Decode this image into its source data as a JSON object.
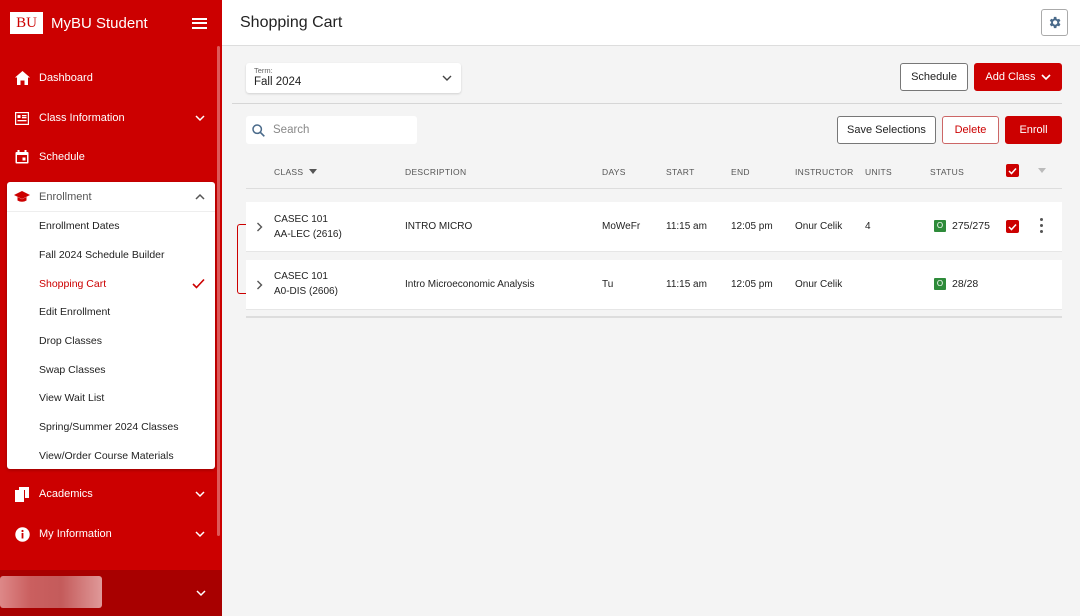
{
  "app": {
    "logo_text": "BU",
    "title": "MyBU Student"
  },
  "sidebar": {
    "items": [
      {
        "label": "Dashboard",
        "icon": "home-icon"
      },
      {
        "label": "Class Information",
        "icon": "class-info-icon"
      },
      {
        "label": "Schedule",
        "icon": "calendar-icon"
      },
      {
        "label": "Enrollment",
        "icon": "graduation-cap-icon"
      },
      {
        "label": "Academics",
        "icon": "documents-icon"
      },
      {
        "label": "My Information",
        "icon": "info-icon"
      }
    ],
    "enrollment_sub": [
      {
        "label": "Enrollment Dates"
      },
      {
        "label": "Fall 2024 Schedule Builder"
      },
      {
        "label": "Shopping Cart",
        "active": true
      },
      {
        "label": "Edit Enrollment"
      },
      {
        "label": "Drop Classes"
      },
      {
        "label": "Swap Classes"
      },
      {
        "label": "View Wait List"
      },
      {
        "label": "Spring/Summer 2024 Classes"
      },
      {
        "label": "View/Order Course Materials"
      }
    ]
  },
  "header": {
    "title": "Shopping Cart"
  },
  "term": {
    "label": "Term:",
    "value": "Fall 2024"
  },
  "toolbar": {
    "schedule_label": "Schedule",
    "add_class_label": "Add Class",
    "save_label": "Save Selections",
    "delete_label": "Delete",
    "enroll_label": "Enroll"
  },
  "search": {
    "placeholder": "Search"
  },
  "table": {
    "headers": {
      "class": "CLASS",
      "description": "DESCRIPTION",
      "days": "DAYS",
      "start": "START",
      "end": "END",
      "instructor": "INSTRUCTOR",
      "units": "UNITS",
      "status": "STATUS"
    },
    "rows": [
      {
        "class_code": "CASEC 101",
        "section": "AA-LEC (2616)",
        "description": "INTRO MICRO",
        "days": "MoWeFr",
        "start": "11:15 am",
        "end": "12:05 pm",
        "instructor": "Onur Celik",
        "units": "4",
        "status_badge": "O",
        "status_count": "275/275",
        "selected": true
      },
      {
        "class_code": "CASEC 101",
        "section": "A0-DIS (2606)",
        "description": "Intro Microeconomic Analysis",
        "days": "Tu",
        "start": "11:15 am",
        "end": "12:05 pm",
        "instructor": "Onur Celik",
        "units": "",
        "status_badge": "O",
        "status_count": "28/28",
        "selected": false
      }
    ]
  },
  "colors": {
    "brand": "#cc0000",
    "status_open": "#2e8b3a"
  }
}
